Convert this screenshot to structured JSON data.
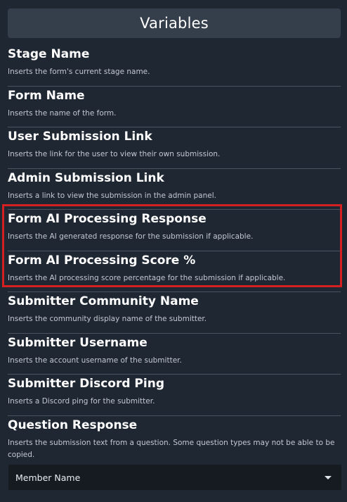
{
  "header": {
    "title": "Variables"
  },
  "variables": [
    {
      "name": "Stage Name",
      "desc": "Inserts the form's current stage name."
    },
    {
      "name": "Form Name",
      "desc": "Inserts the name of the form."
    },
    {
      "name": "User Submission Link",
      "desc": "Inserts the link for the user to view their own submission."
    },
    {
      "name": "Admin Submission Link",
      "desc": "Inserts a link to view the submission in the admin panel."
    },
    {
      "name": "Form AI Processing Response",
      "desc": "Inserts the AI generated response for the submission if applicable."
    },
    {
      "name": "Form AI Processing Score %",
      "desc": "Inserts the AI processing score percentage for the submission if applicable."
    },
    {
      "name": "Submitter Community Name",
      "desc": "Inserts the community display name of the submitter."
    },
    {
      "name": "Submitter Username",
      "desc": "Inserts the account username of the submitter."
    },
    {
      "name": "Submitter Discord Ping",
      "desc": "Inserts a Discord ping for the submitter."
    },
    {
      "name": "Question Response",
      "desc": "Inserts the submission text from a question. Some question types may not be able to be copied."
    }
  ],
  "question_select": {
    "value": "Member Name"
  },
  "colors": {
    "background": "#1f2733",
    "header": "#353e4b",
    "highlight": "#d42020",
    "select_bg": "#161b22"
  }
}
